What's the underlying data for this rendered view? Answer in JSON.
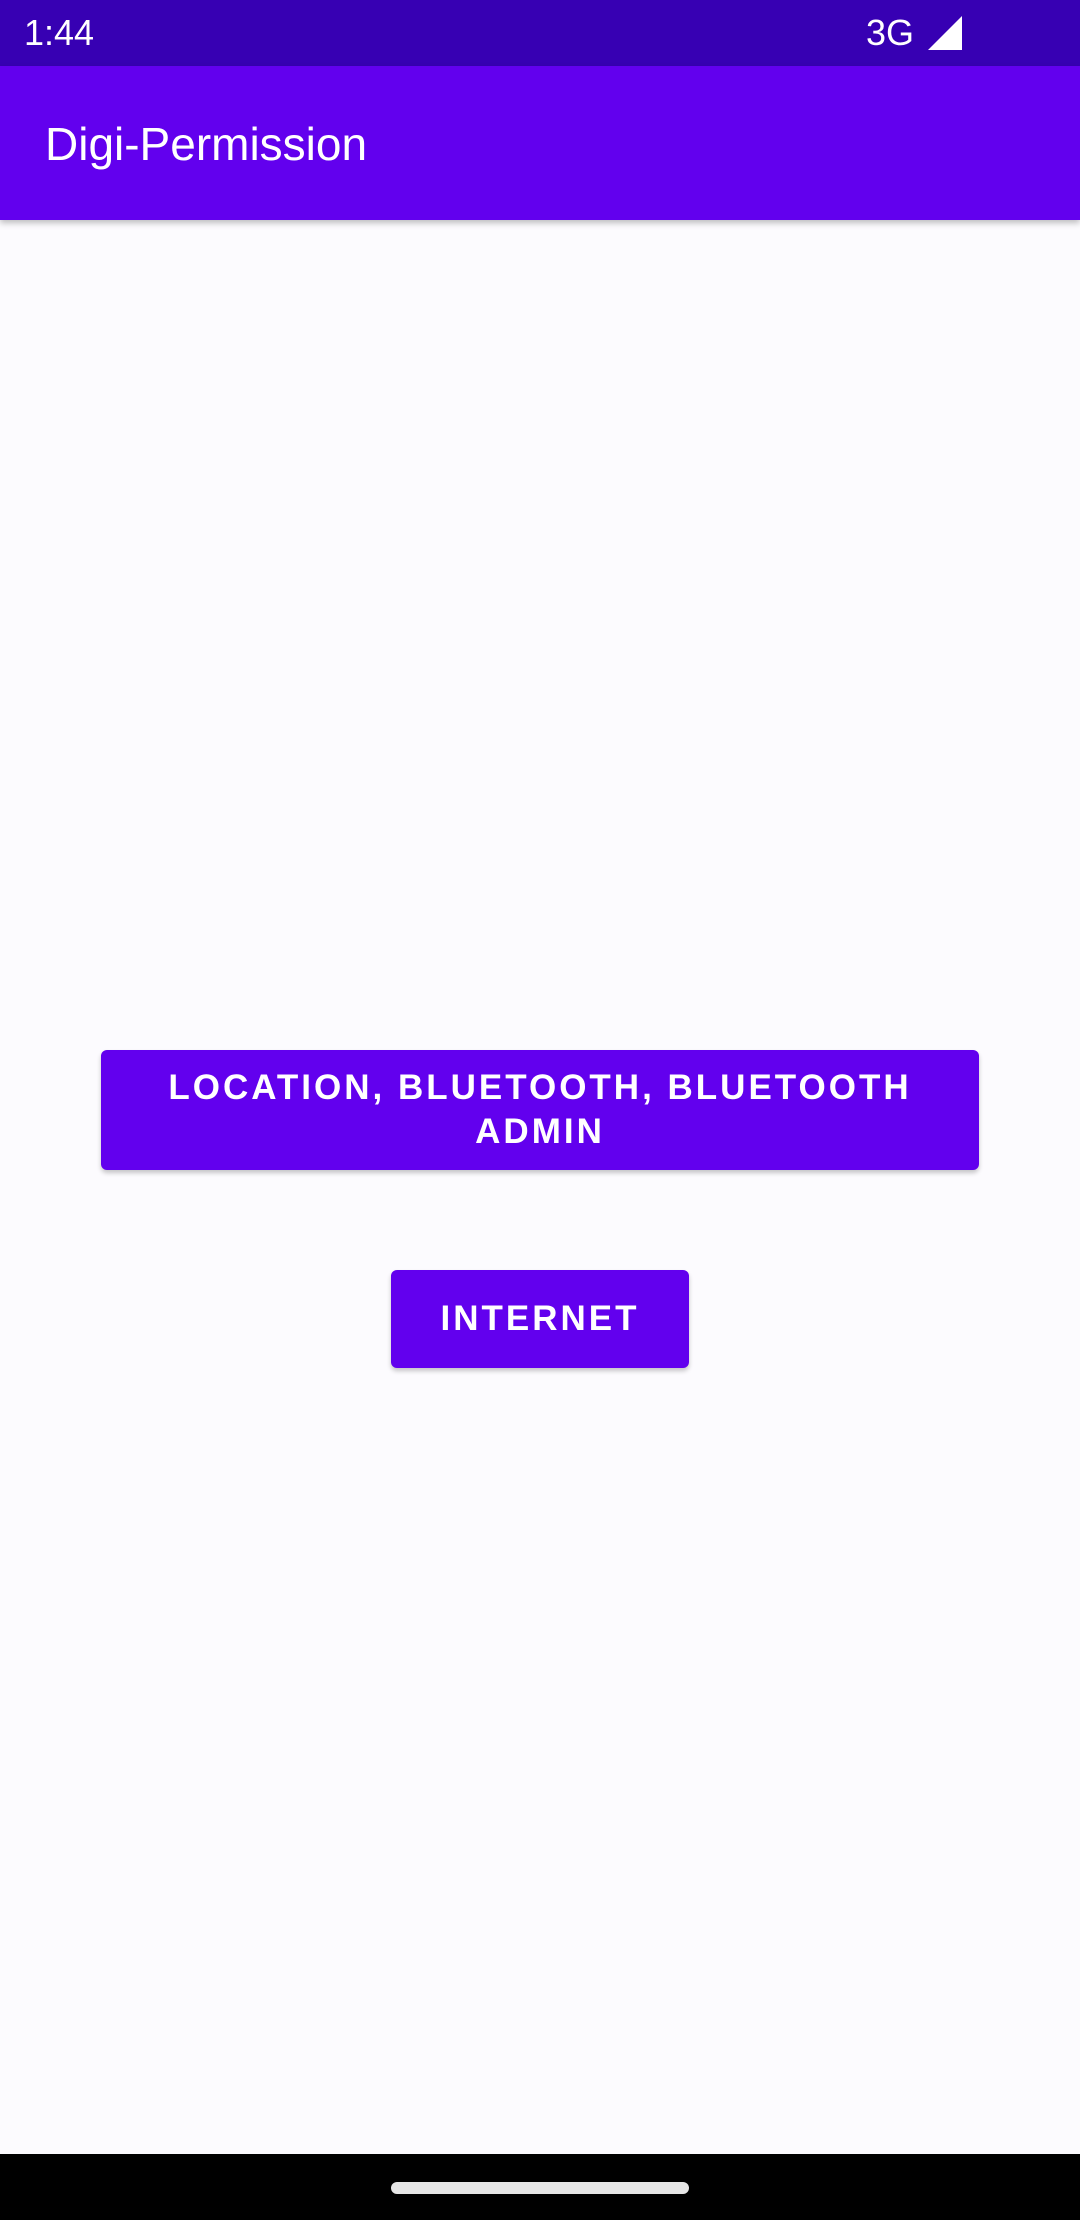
{
  "status_bar": {
    "time": "1:44",
    "network": "3G",
    "signal_icon": "cellular-signal-icon"
  },
  "app_bar": {
    "title": "Digi-Permission"
  },
  "buttons": {
    "permissions_label": "LOCATION, BLUETOOTH, BLUETOOTH ADMIN",
    "internet_label": "INTERNET"
  },
  "nav_bar": {
    "home_handle": "home-gesture-handle"
  },
  "colors": {
    "status_bar": "#3700B3",
    "primary": "#6200EE",
    "background": "#FCFBFE",
    "on_primary": "#FFFFFF"
  }
}
